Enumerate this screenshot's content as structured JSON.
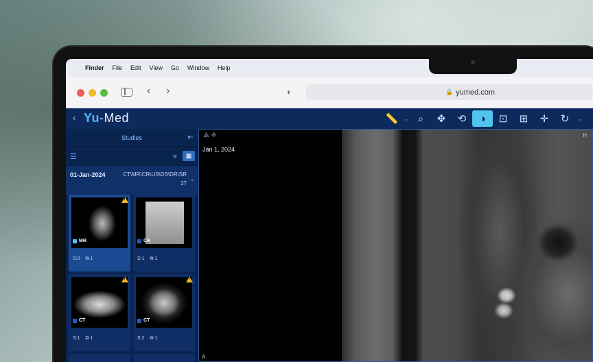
{
  "menubar": {
    "items": [
      "Finder",
      "File",
      "Edit",
      "View",
      "Go",
      "Window",
      "Help"
    ]
  },
  "browser": {
    "url": "yumed.com"
  },
  "app": {
    "logo_a": "Yu",
    "logo_b": "-Med",
    "accent": "#52c4f0",
    "tools": [
      "ruler-icon",
      "zoom-icon",
      "pan-icon",
      "rotate-icon",
      "contrast-icon",
      "camera-icon",
      "layout-icon",
      "crosshair-icon",
      "reset-icon"
    ]
  },
  "studies": {
    "title": "Studies",
    "row": {
      "date": "01-Jan-2024",
      "modalities": "CT\\MR\\CR\\US\\DS\\DR\\SR",
      "count": "27"
    },
    "cards": [
      {
        "modality": "MR",
        "color": "#4fc3f7",
        "series": "S:0",
        "images": "1"
      },
      {
        "modality": "CR",
        "color": "#1f5fbf",
        "series": "S:1",
        "images": "1"
      },
      {
        "modality": "CT",
        "color": "#1f5fbf",
        "series": "S:1",
        "images": "1"
      },
      {
        "modality": "CT",
        "color": "#1f5fbf",
        "series": "S:2",
        "images": "1"
      }
    ]
  },
  "viewer": {
    "date": "Jan 1, 2024",
    "top_marker": "H",
    "bottom_marker": "A"
  }
}
